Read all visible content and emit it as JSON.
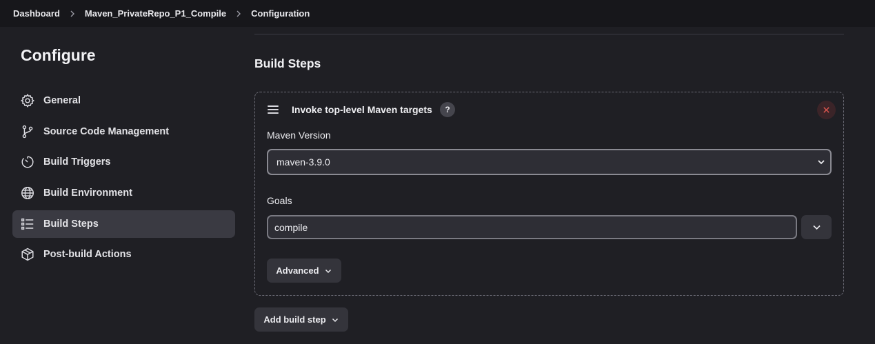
{
  "breadcrumb": [
    {
      "label": "Dashboard"
    },
    {
      "label": "Maven_PrivateRepo_P1_Compile"
    },
    {
      "label": "Configuration"
    }
  ],
  "sidebar": {
    "title": "Configure",
    "items": [
      {
        "label": "General",
        "icon": "gear-icon",
        "active": false
      },
      {
        "label": "Source Code Management",
        "icon": "git-branch-icon",
        "active": false
      },
      {
        "label": "Build Triggers",
        "icon": "timer-icon",
        "active": false
      },
      {
        "label": "Build Environment",
        "icon": "globe-icon",
        "active": false
      },
      {
        "label": "Build Steps",
        "icon": "list-icon",
        "active": true
      },
      {
        "label": "Post-build Actions",
        "icon": "package-icon",
        "active": false
      }
    ]
  },
  "main": {
    "section_title": "Build Steps",
    "step": {
      "title": "Invoke top-level Maven targets",
      "help_label": "?",
      "maven_version_label": "Maven Version",
      "maven_version_value": "maven-3.9.0",
      "goals_label": "Goals",
      "goals_value": "compile",
      "advanced_label": "Advanced"
    },
    "add_build_step_label": "Add build step"
  },
  "colors": {
    "background": "#1f1f24",
    "topbar": "#17171b",
    "active_nav": "#3a3a42",
    "close_icon": "#d9534f"
  }
}
